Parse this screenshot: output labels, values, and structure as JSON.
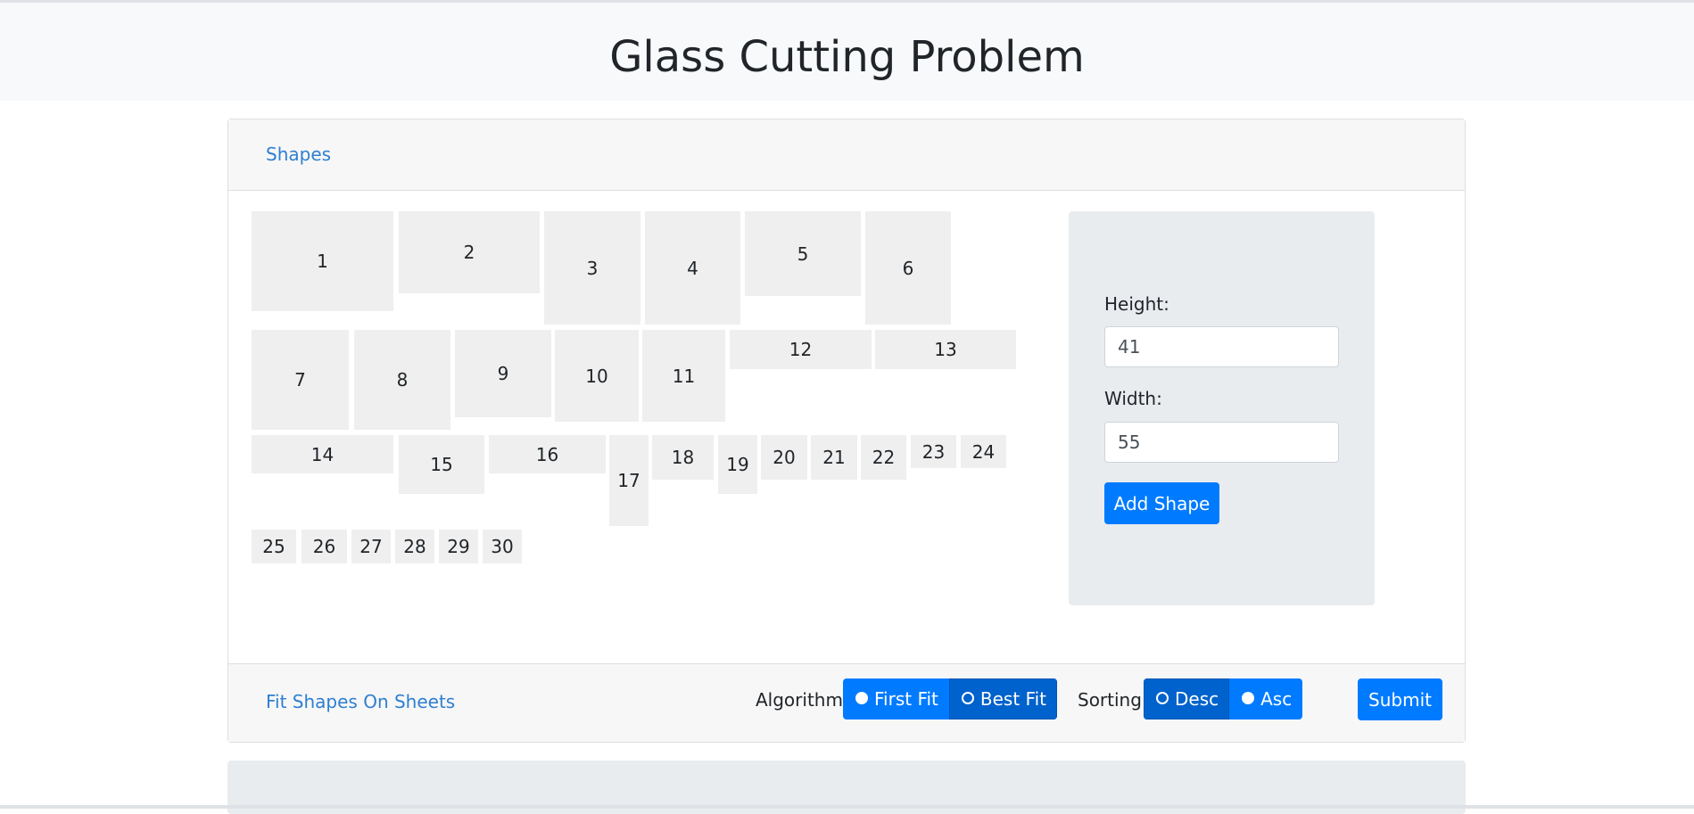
{
  "page": {
    "title": "Glass Cutting Problem"
  },
  "shapes_card": {
    "header_link": "Shapes",
    "shapes": [
      "1",
      "2",
      "3",
      "4",
      "5",
      "6",
      "7",
      "8",
      "9",
      "10",
      "11",
      "12",
      "13",
      "14",
      "15",
      "16",
      "17",
      "18",
      "19",
      "20",
      "21",
      "22",
      "23",
      "24",
      "25",
      "26",
      "27",
      "28",
      "29",
      "30"
    ]
  },
  "form": {
    "height_label": "Height:",
    "height_value": "41",
    "width_label": "Width:",
    "width_value": "55",
    "add_button": "Add Shape"
  },
  "footer": {
    "link": "Fit Shapes On Sheets",
    "algorithm_label": "Algorithm:",
    "algorithm_options": [
      "First Fit",
      "Best Fit"
    ],
    "algorithm_selected": "First Fit",
    "sorting_label": "Sorting:",
    "sorting_options": [
      "Desc",
      "Asc"
    ],
    "sorting_selected": "Asc",
    "submit": "Submit"
  },
  "colors": {
    "primary": "#007bff",
    "primary_active": "#0062cc",
    "link": "#2e7fd1",
    "shape_fill": "#efefef",
    "panel": "#e9ecef"
  }
}
